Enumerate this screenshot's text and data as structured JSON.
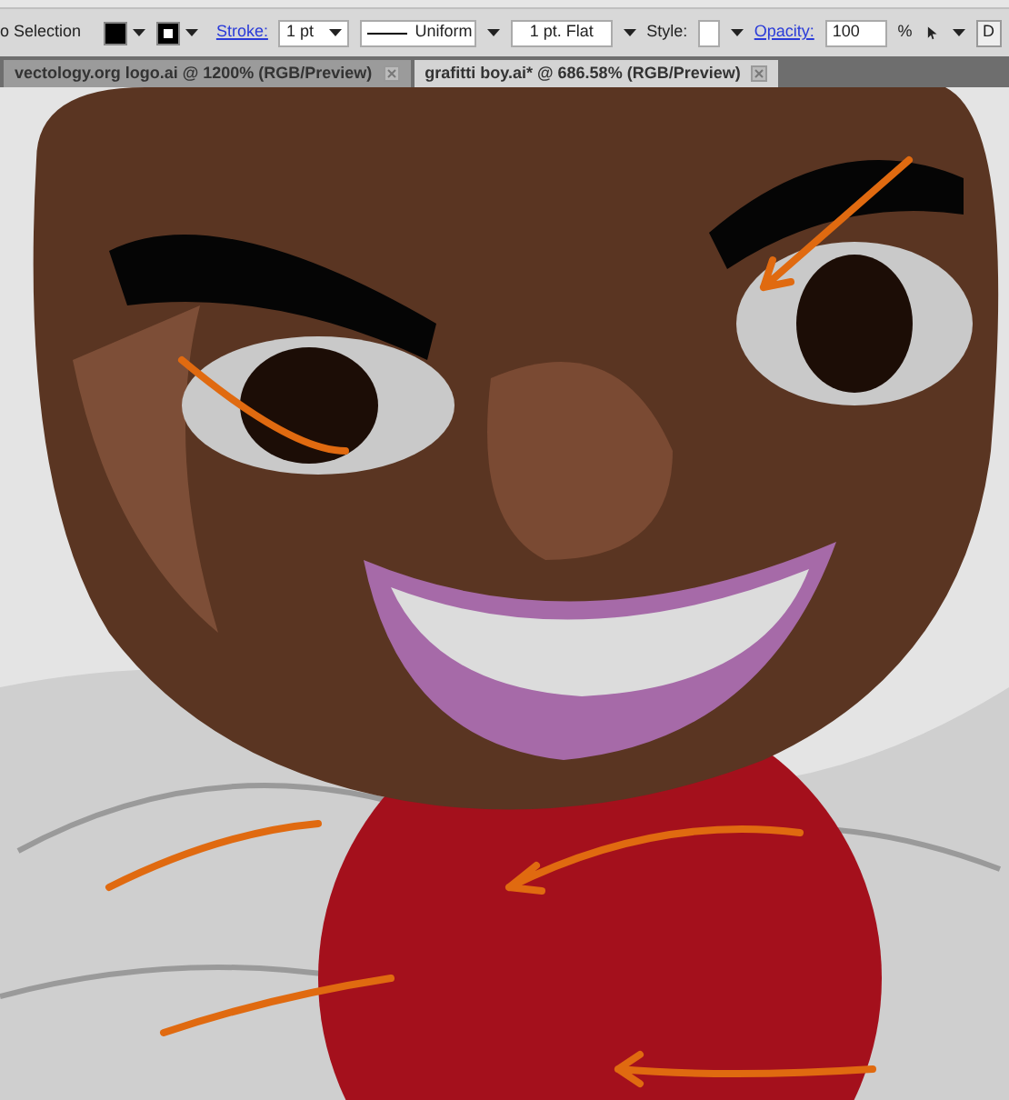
{
  "control_bar": {
    "selection_label": "o Selection",
    "stroke_label": "Stroke:",
    "stroke_weight": "1 pt",
    "profile": "Uniform",
    "brush": "1 pt. Flat",
    "style_label": "Style:",
    "opacity_label": "Opacity:",
    "opacity_value": "100",
    "percent": "%",
    "cut_button": "D"
  },
  "tabs": [
    {
      "label": "vectology.org logo.ai @ 1200% (RGB/Preview)",
      "selected": false
    },
    {
      "label": "grafitti boy.ai* @ 686.58% (RGB/Preview)",
      "selected": true
    }
  ]
}
